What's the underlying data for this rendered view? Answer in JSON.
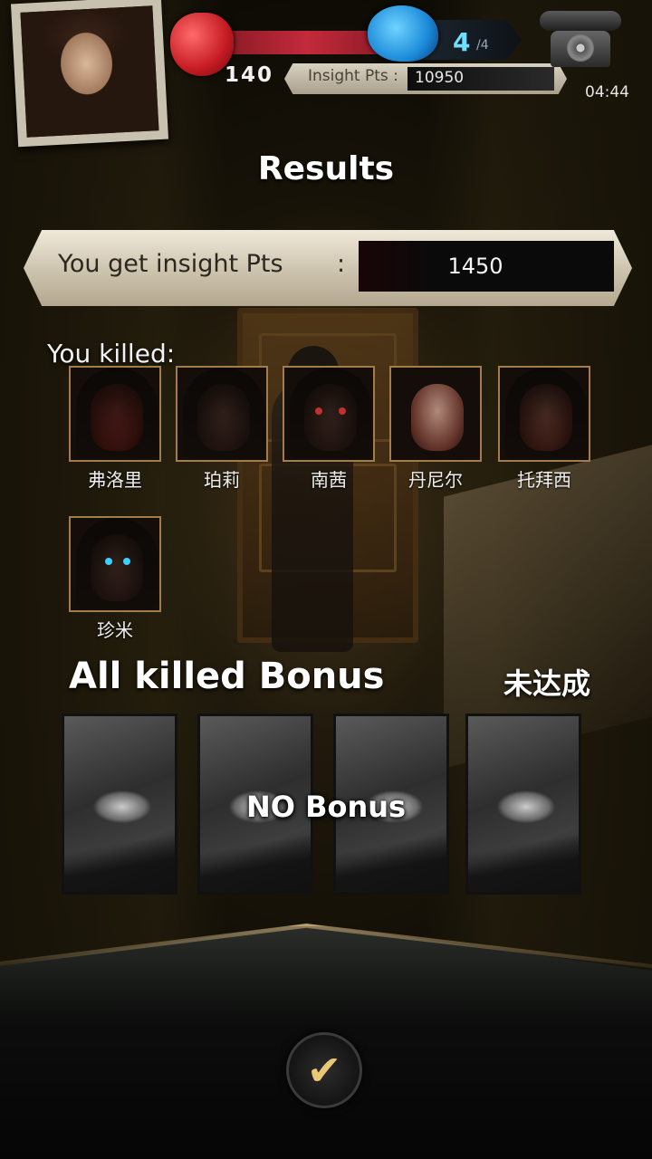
{
  "hud": {
    "hp_value": "140",
    "brain_count": "4",
    "brain_max": "/4",
    "insight_label": "Insight Pts :",
    "insight_value": "10950",
    "timer": "04:44"
  },
  "results": {
    "title": "Results",
    "gain_label": "You get insight Pts",
    "gain_colon": ":",
    "gain_value": "1450"
  },
  "killed": {
    "label": "You killed:",
    "victims": [
      {
        "name": "弗洛里"
      },
      {
        "name": "珀莉"
      },
      {
        "name": "南茜"
      },
      {
        "name": "丹尼尔"
      },
      {
        "name": "托拜西"
      },
      {
        "name": "珍米"
      }
    ]
  },
  "bonus": {
    "title": "All killed Bonus",
    "status": "未达成",
    "overlay": "NO Bonus",
    "card_count": 4
  },
  "colors": {
    "accent_gold": "#e9c777",
    "hp_red": "#c42a3b",
    "brain_blue": "#6fe0ff"
  },
  "icons": [
    "heart-icon",
    "brain-icon",
    "telephone-icon",
    "check-icon"
  ]
}
